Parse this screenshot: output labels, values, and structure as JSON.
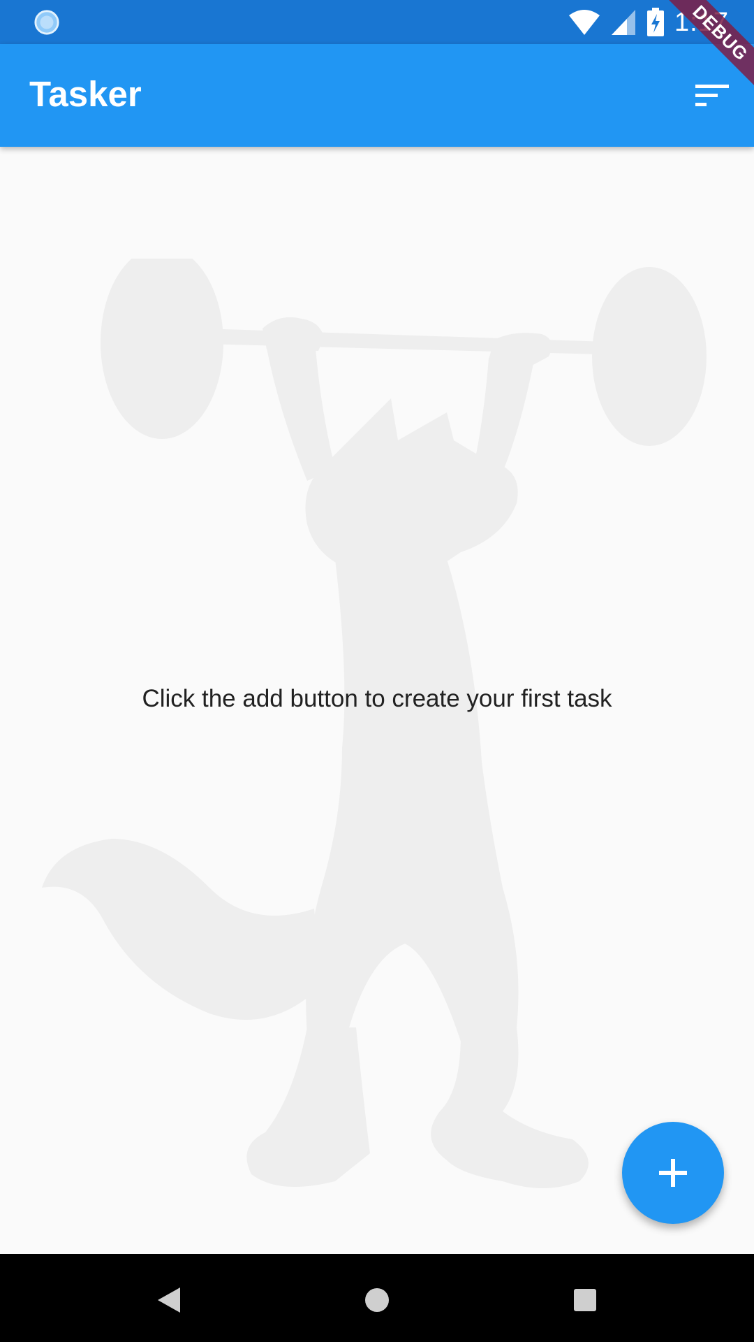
{
  "status_bar": {
    "time": "1:17",
    "icons": [
      "loading-icon",
      "wifi-icon",
      "cellular-signal-icon",
      "battery-charging-icon"
    ]
  },
  "debug_banner": {
    "label": "DEBUG"
  },
  "app_bar": {
    "title": "Tasker",
    "sort_icon": "sort-icon"
  },
  "main": {
    "empty_message": "Click the add button to create your first task",
    "illustration": "fox-weightlifter-illustration"
  },
  "fab": {
    "icon": "add-icon"
  },
  "nav_bar": {
    "icons": [
      "back-icon",
      "home-icon",
      "recents-icon"
    ]
  },
  "colors": {
    "primary": "#2196f3",
    "primary_dark": "#1976d2",
    "background": "#fafafa",
    "illustration": "#eeeeee",
    "debug_banner": "#7d1e46"
  }
}
